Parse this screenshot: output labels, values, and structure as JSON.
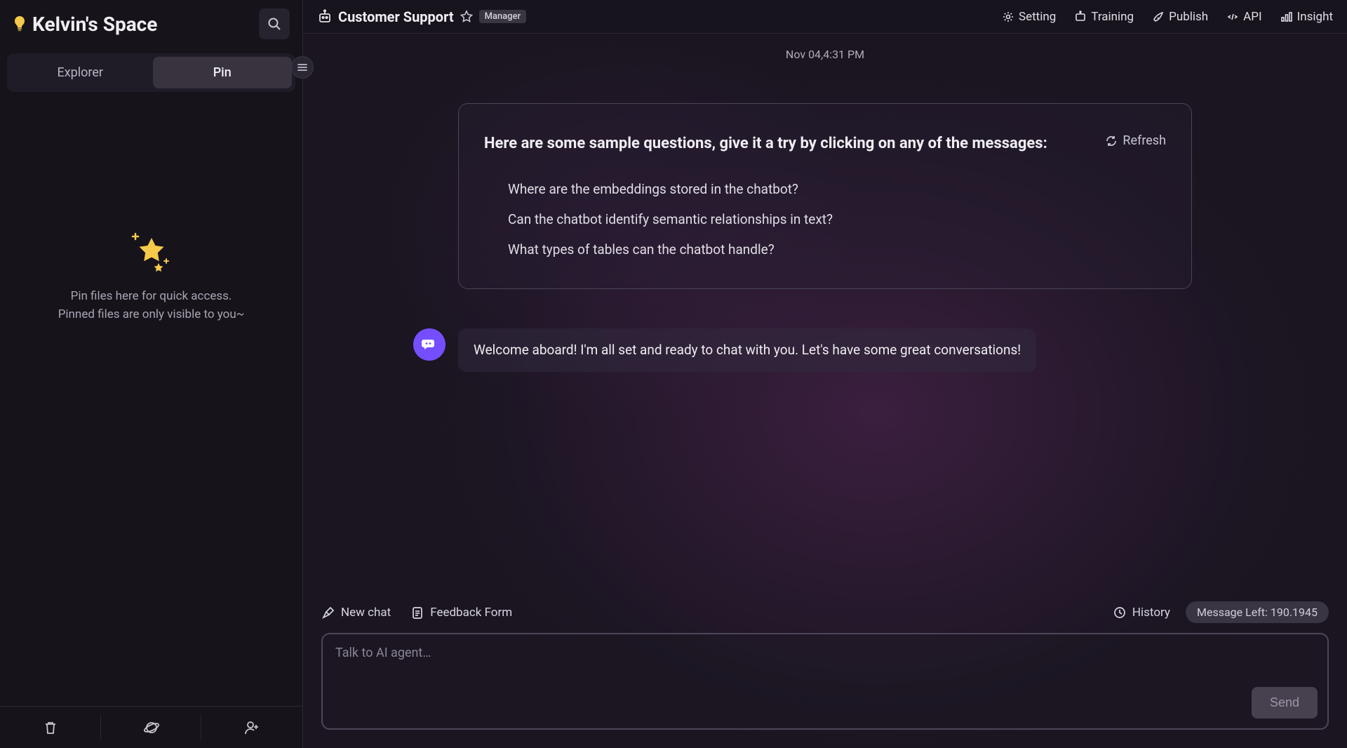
{
  "sidebar": {
    "workspace_title": "Kelvin's Space",
    "tabs": {
      "explorer": "Explorer",
      "pin": "Pin"
    },
    "empty_pin_line1": "Pin files here for quick access.",
    "empty_pin_line2": "Pinned files are only visible to you~",
    "footer_icons": [
      "trash-icon",
      "explore-icon",
      "add-user-icon"
    ]
  },
  "header": {
    "bot_name": "Customer Support",
    "badge": "Manager",
    "nav": {
      "setting": "Setting",
      "training": "Training",
      "publish": "Publish",
      "api": "API",
      "insight": "Insight"
    }
  },
  "chat": {
    "timestamp": "Nov 04,4:31 PM",
    "sample_heading": "Here are some sample questions, give it a try by clicking on any of the messages:",
    "refresh_label": "Refresh",
    "sample_questions": [
      "Where are the embeddings stored in the chatbot?",
      "Can the chatbot identify semantic relationships in text?",
      "What types of tables can the chatbot handle?"
    ],
    "welcome_message": "Welcome aboard! I'm all set and ready to chat with you. Let's have some great conversations!"
  },
  "controls": {
    "new_chat": "New chat",
    "feedback_form": "Feedback Form",
    "history": "History",
    "message_left": "Message Left: 190.1945"
  },
  "input": {
    "placeholder": "Talk to AI agent…",
    "send_label": "Send"
  }
}
